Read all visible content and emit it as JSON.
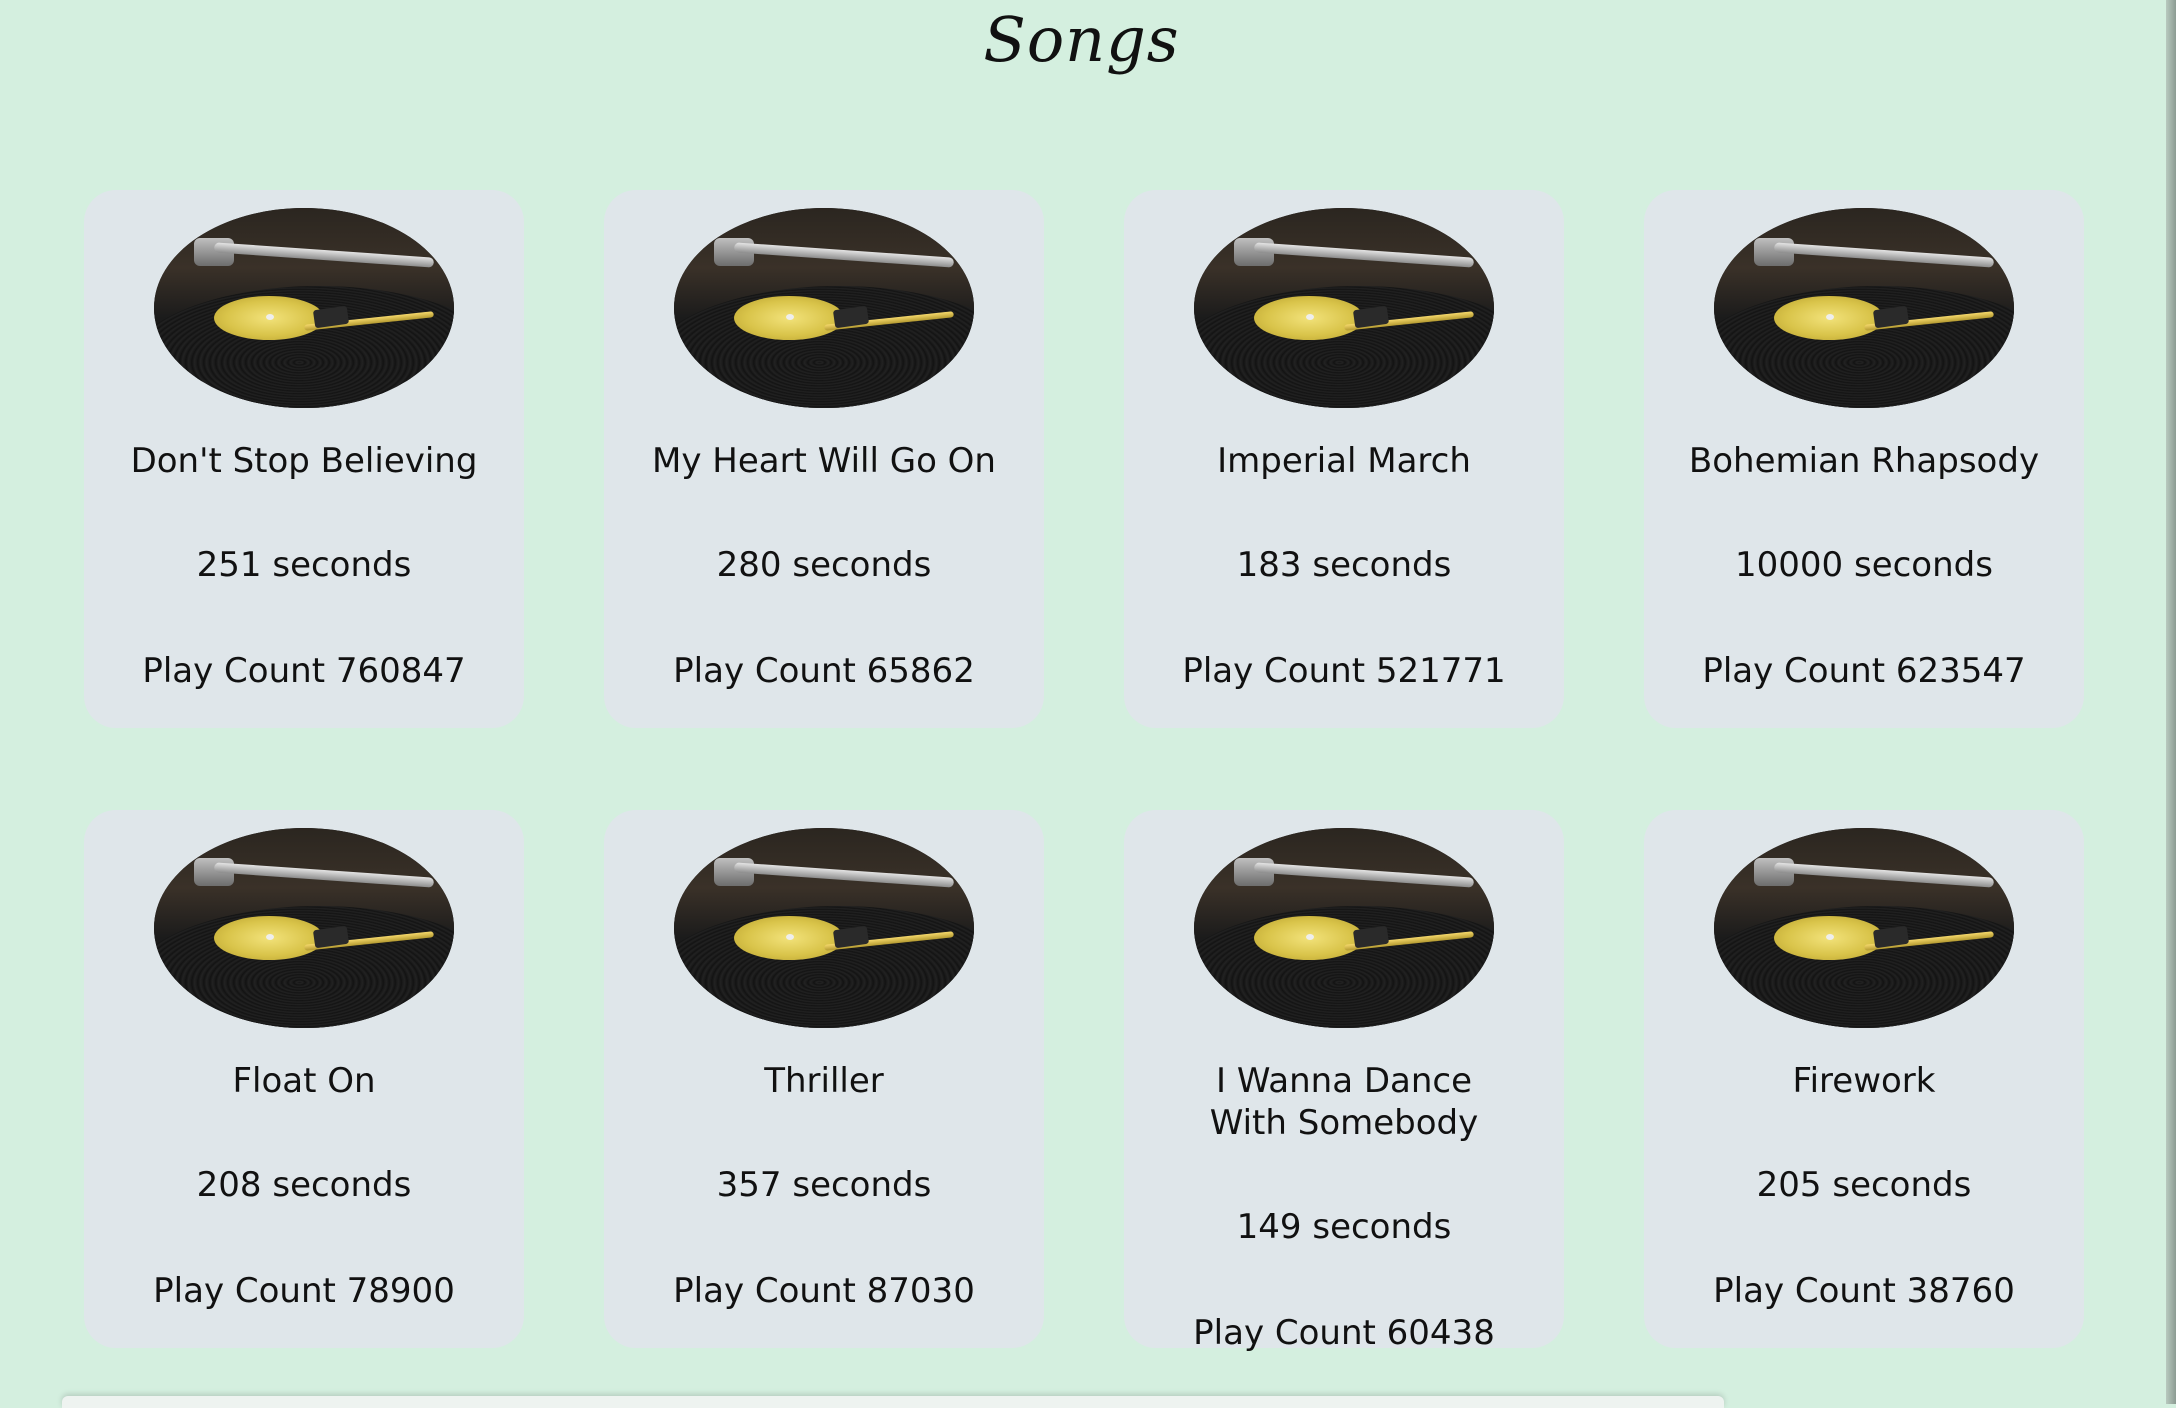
{
  "page": {
    "title": "Songs",
    "background_color": "#d4efdf",
    "card_color": "#dfe6ea"
  },
  "songs": [
    {
      "title": "Don't Stop Believing",
      "duration": "251 seconds",
      "play_count": "Play Count 760847"
    },
    {
      "title": "My Heart Will Go On",
      "duration": "280 seconds",
      "play_count": "Play Count 65862"
    },
    {
      "title": "Imperial March",
      "duration": "183 seconds",
      "play_count": "Play Count 521771"
    },
    {
      "title": "Bohemian Rhapsody",
      "duration": "10000 seconds",
      "play_count": "Play Count 623547"
    },
    {
      "title": "Float On",
      "duration": "208 seconds",
      "play_count": "Play Count 78900"
    },
    {
      "title": "Thriller",
      "duration": "357 seconds",
      "play_count": "Play Count 87030"
    },
    {
      "title": "I Wanna Dance With Somebody",
      "duration": "149 seconds",
      "play_count": "Play Count 60438"
    },
    {
      "title": "Firework",
      "duration": "205 seconds",
      "play_count": "Play Count 38760"
    }
  ],
  "icons": {
    "song_image": "turntable-record-image"
  }
}
